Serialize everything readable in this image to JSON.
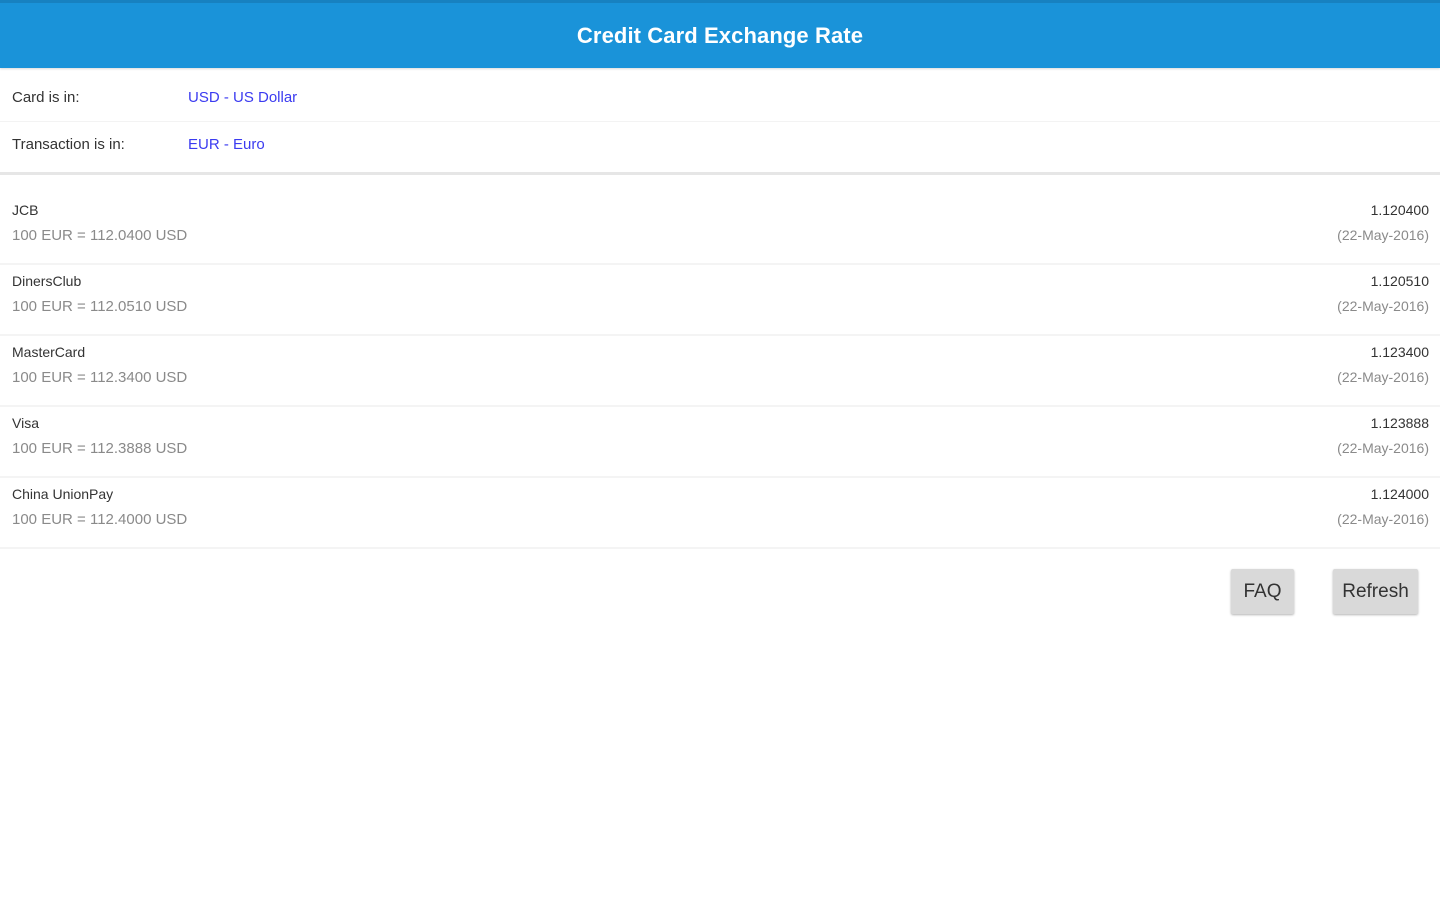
{
  "header": {
    "title": "Credit Card Exchange Rate"
  },
  "settings": {
    "card": {
      "label": "Card is in:",
      "value": "USD - US Dollar"
    },
    "transaction": {
      "label": "Transaction is in:",
      "value": "EUR - Euro"
    }
  },
  "rates": [
    {
      "name": "JCB",
      "detail": "100 EUR = 112.0400 USD",
      "rate": "1.120400",
      "date": "(22-May-2016)"
    },
    {
      "name": "DinersClub",
      "detail": "100 EUR = 112.0510 USD",
      "rate": "1.120510",
      "date": "(22-May-2016)"
    },
    {
      "name": "MasterCard",
      "detail": "100 EUR = 112.3400 USD",
      "rate": "1.123400",
      "date": "(22-May-2016)"
    },
    {
      "name": "Visa",
      "detail": "100 EUR = 112.3888 USD",
      "rate": "1.123888",
      "date": "(22-May-2016)"
    },
    {
      "name": "China UnionPay",
      "detail": "100 EUR = 112.4000 USD",
      "rate": "1.124000",
      "date": "(22-May-2016)"
    }
  ],
  "buttons": {
    "faq": "FAQ",
    "refresh": "Refresh"
  },
  "colors": {
    "app_bar": "#1a93d9",
    "link": "#3b3bf0",
    "button_bg": "#d9d9d9"
  }
}
